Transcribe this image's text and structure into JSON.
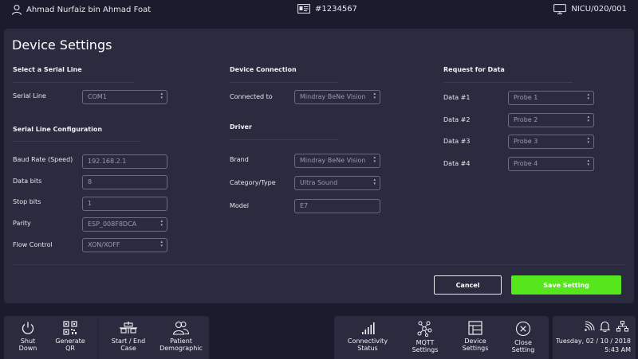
{
  "header": {
    "user_name": "Ahmad Nurfaiz bin Ahmad Foat",
    "patient_id": "#1234567",
    "location": "NICU/020/001"
  },
  "page": {
    "title": "Device Settings"
  },
  "serial_line": {
    "section_title": "Select a Serial Line",
    "label": "Serial Line",
    "value": "COM1"
  },
  "serial_config": {
    "section_title": "Serial Line Configuration",
    "baud_rate": {
      "label": "Baud Rate (Speed)",
      "value": "192.168.2.1"
    },
    "data_bits": {
      "label": "Data bits",
      "value": "8"
    },
    "stop_bits": {
      "label": "Stop bits",
      "value": "1"
    },
    "parity": {
      "label": "Parity",
      "value": "ESP_008F8DCA"
    },
    "flow_control": {
      "label": "Flow Control",
      "value": "XON/XOFF"
    }
  },
  "device_connection": {
    "section_title": "Device Connection",
    "label": "Connected to",
    "value": "Mindray BeNe Vision"
  },
  "driver": {
    "section_title": "Driver",
    "brand": {
      "label": "Brand",
      "value": "Mindray BeNe Vision"
    },
    "category": {
      "label": "Category/Type",
      "value": "Ultra Sound"
    },
    "model": {
      "label": "Model",
      "value": "E7"
    }
  },
  "request_data": {
    "section_title": "Request for Data",
    "items": [
      {
        "label": "Data #1",
        "value": "Probe 1"
      },
      {
        "label": "Data #2",
        "value": "Probe 2"
      },
      {
        "label": "Data #3",
        "value": "Probe 3"
      },
      {
        "label": "Data #4",
        "value": "Probe 4"
      }
    ]
  },
  "actions": {
    "cancel_label": "Cancel",
    "save_label": "Save Setting",
    "save_color": "#55e61c"
  },
  "dock": {
    "shutdown_label": "Shut\nDown",
    "qr_label": "Generate\nQR",
    "case_label": "Start / End\nCase",
    "demographic_label": "Patient\nDemographic",
    "connectivity_label": "Connectivity\nStatus",
    "mqtt_label": "MQTT\nSettings",
    "device_label": "Device\nSettings",
    "close_label": "Close\nSetting"
  },
  "status": {
    "date": "Tuesday, 02 / 10 / 2018",
    "time": "5:43 AM"
  },
  "icons": [
    "user-icon",
    "id-card-icon",
    "monitor-icon",
    "power-icon",
    "qr-code-icon",
    "case-icon",
    "patients-icon",
    "signal-bars-icon",
    "network-icon",
    "grid-window-icon",
    "close-circle-icon",
    "wifi-icon",
    "bell-icon",
    "sitemap-icon"
  ]
}
